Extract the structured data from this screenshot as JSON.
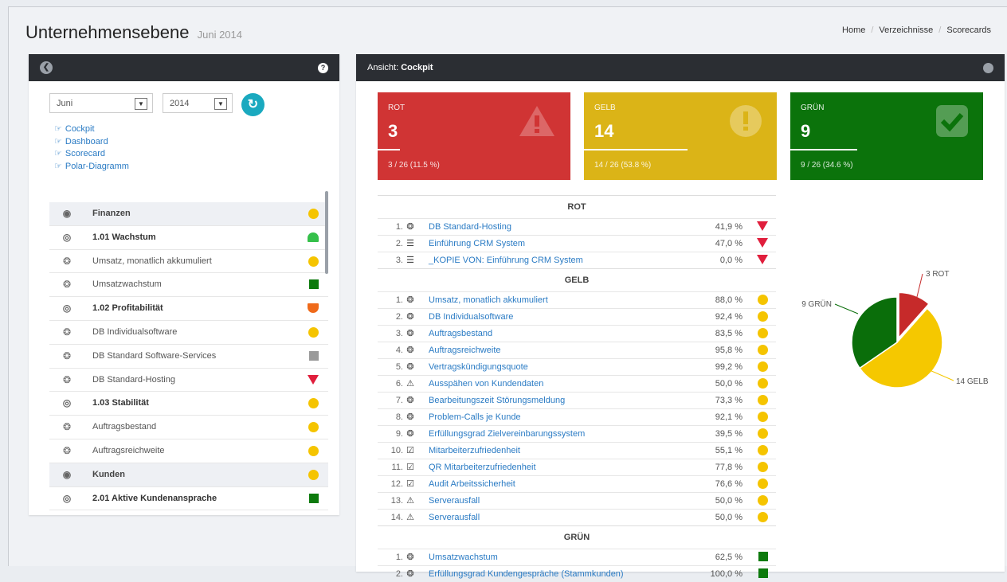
{
  "header": {
    "title": "Unternehmensebene",
    "subtitle": "Juni 2014"
  },
  "breadcrumb": [
    "Home",
    "Verzeichnisse",
    "Scorecards"
  ],
  "left_panel": {
    "month": "Juni",
    "year": "2014",
    "links": [
      "Cockpit",
      "Dashboard",
      "Scorecard",
      "Polar-Diagramm"
    ],
    "items": [
      {
        "label": "Finanzen",
        "icon": "eye-icon",
        "kind": "group",
        "status": "yellow-circle"
      },
      {
        "label": "1.01 Wachstum",
        "icon": "target-icon",
        "kind": "bold",
        "status": "green-half"
      },
      {
        "label": "Umsatz, monatlich akkumuliert",
        "icon": "gauge-icon",
        "kind": "normal",
        "status": "yellow-circle"
      },
      {
        "label": "Umsatzwachstum",
        "icon": "gauge-icon",
        "kind": "normal",
        "status": "green-square"
      },
      {
        "label": "1.02 Profitabilität",
        "icon": "target-icon",
        "kind": "bold",
        "status": "orange-half"
      },
      {
        "label": "DB Individualsoftware",
        "icon": "gauge-icon",
        "kind": "normal",
        "status": "yellow-circle"
      },
      {
        "label": "DB Standard Software-Services",
        "icon": "gauge-icon",
        "kind": "normal",
        "status": "grey-square"
      },
      {
        "label": "DB Standard-Hosting",
        "icon": "gauge-icon",
        "kind": "normal",
        "status": "red-triangle"
      },
      {
        "label": "1.03 Stabilität",
        "icon": "target-icon",
        "kind": "bold",
        "status": "yellow-circle"
      },
      {
        "label": "Auftragsbestand",
        "icon": "gauge-icon",
        "kind": "normal",
        "status": "yellow-circle"
      },
      {
        "label": "Auftragsreichweite",
        "icon": "gauge-icon",
        "kind": "normal",
        "status": "yellow-circle"
      },
      {
        "label": "Kunden",
        "icon": "eye-icon",
        "kind": "group",
        "status": "yellow-circle"
      },
      {
        "label": "2.01 Aktive Kundenansprache",
        "icon": "target-icon",
        "kind": "bold",
        "status": "green-square"
      }
    ]
  },
  "right_panel": {
    "view_label": "Ansicht:",
    "view_name": "Cockpit",
    "cards": [
      {
        "label": "ROT",
        "value": "3",
        "footer": "3 / 26 (11.5 %)",
        "fraction": 0.115,
        "color": "#d03434"
      },
      {
        "label": "GELB",
        "value": "14",
        "footer": "14 / 26 (53.8 %)",
        "fraction": 0.538,
        "color": "#dbb417"
      },
      {
        "label": "GRÜN",
        "value": "9",
        "footer": "9 / 26 (34.6 %)",
        "fraction": 0.346,
        "color": "#0b730b"
      }
    ],
    "sections": [
      {
        "title": "ROT",
        "rows": [
          {
            "num": "1.",
            "icon": "gauge-icon",
            "name": "DB Standard-Hosting",
            "pct": "41,9 %",
            "status": "red-triangle"
          },
          {
            "num": "2.",
            "icon": "server-icon",
            "name": "Einführung CRM System",
            "pct": "47,0 %",
            "status": "red-triangle"
          },
          {
            "num": "3.",
            "icon": "server-icon",
            "name": "_KOPIE VON: Einführung CRM System",
            "pct": "0,0 %",
            "status": "red-triangle"
          }
        ]
      },
      {
        "title": "GELB",
        "rows": [
          {
            "num": "1.",
            "icon": "gauge-icon",
            "name": "Umsatz, monatlich akkumuliert",
            "pct": "88,0 %",
            "status": "yellow-circle"
          },
          {
            "num": "2.",
            "icon": "gauge-icon",
            "name": "DB Individualsoftware",
            "pct": "92,4 %",
            "status": "yellow-circle"
          },
          {
            "num": "3.",
            "icon": "gauge-icon",
            "name": "Auftragsbestand",
            "pct": "83,5 %",
            "status": "yellow-circle"
          },
          {
            "num": "4.",
            "icon": "gauge-icon",
            "name": "Auftragsreichweite",
            "pct": "95,8 %",
            "status": "yellow-circle"
          },
          {
            "num": "5.",
            "icon": "gauge-icon",
            "name": "Vertragskündigungsquote",
            "pct": "99,2 %",
            "status": "yellow-circle"
          },
          {
            "num": "6.",
            "icon": "warning-icon",
            "name": "Ausspähen von Kundendaten",
            "pct": "50,0 %",
            "status": "yellow-circle"
          },
          {
            "num": "7.",
            "icon": "gauge-icon",
            "name": "Bearbeitungszeit Störungsmeldung",
            "pct": "73,3 %",
            "status": "yellow-circle"
          },
          {
            "num": "8.",
            "icon": "gauge-icon",
            "name": "Problem-Calls je Kunde",
            "pct": "92,1 %",
            "status": "yellow-circle"
          },
          {
            "num": "9.",
            "icon": "gauge-icon",
            "name": "Erfüllungsgrad Zielvereinbarungssystem",
            "pct": "39,5 %",
            "status": "yellow-circle"
          },
          {
            "num": "10.",
            "icon": "checkbox-icon",
            "name": "Mitarbeiterzufriedenheit",
            "pct": "55,1 %",
            "status": "yellow-circle"
          },
          {
            "num": "11.",
            "icon": "checkbox-icon",
            "name": "QR Mitarbeiterzufriedenheit",
            "pct": "77,8 %",
            "status": "yellow-circle"
          },
          {
            "num": "12.",
            "icon": "checkbox-icon",
            "name": "Audit Arbeitssicherheit",
            "pct": "76,6 %",
            "status": "yellow-circle"
          },
          {
            "num": "13.",
            "icon": "warning-icon",
            "name": "Serverausfall",
            "pct": "50,0 %",
            "status": "yellow-circle"
          },
          {
            "num": "14.",
            "icon": "warning-icon",
            "name": "Serverausfall",
            "pct": "50,0 %",
            "status": "yellow-circle"
          }
        ]
      },
      {
        "title": "GRÜN",
        "rows": [
          {
            "num": "1.",
            "icon": "gauge-icon",
            "name": "Umsatzwachstum",
            "pct": "62,5 %",
            "status": "green-square"
          },
          {
            "num": "2.",
            "icon": "gauge-icon",
            "name": "Erfüllungsgrad Kundengespräche (Stammkunden)",
            "pct": "100,0 %",
            "status": "green-square"
          }
        ]
      }
    ]
  },
  "pie": {
    "slices": [
      {
        "label": "3 ROT",
        "value": 3,
        "color": "#c62a2a"
      },
      {
        "label": "14 GELB",
        "value": 14,
        "color": "#f5c800"
      },
      {
        "label": "9 GRÜN",
        "value": 9,
        "color": "#0a6e0a"
      }
    ]
  }
}
